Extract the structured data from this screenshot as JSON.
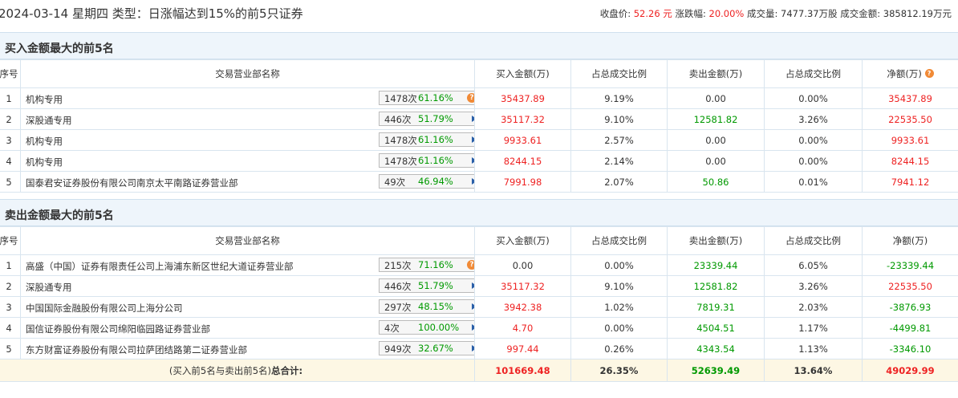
{
  "header": {
    "title": "2024-03-14 星期四 类型：日涨幅达到15%的前5只证券",
    "close_label": "收盘价:",
    "close_value": "52.26 元",
    "change_label": "涨跌幅:",
    "change_value": "20.00%",
    "volume_label": "成交量:",
    "volume_value": "7477.37万股",
    "amount_label": "成交金额:",
    "amount_value": "385812.19万元"
  },
  "columns": {
    "seq": "序号",
    "dept": "交易营业部名称",
    "buy": "买入金额(万)",
    "buy_ratio": "占总成交比例",
    "sell": "卖出金额(万)",
    "sell_ratio": "占总成交比例",
    "net": "净额(万)"
  },
  "buy_section": {
    "title": "买入金额最大的前5名",
    "rows": [
      {
        "seq": "1",
        "name": "机构专用",
        "count": "1478次",
        "rate": "61.16%",
        "buy": "35437.89",
        "buy_ratio": "9.19%",
        "sell": "0.00",
        "sell_ratio": "0.00%",
        "net": "35437.89"
      },
      {
        "seq": "2",
        "name": "深股通专用",
        "count": "446次",
        "rate": "51.79%",
        "buy": "35117.32",
        "buy_ratio": "9.10%",
        "sell": "12581.82",
        "sell_ratio": "3.26%",
        "net": "22535.50"
      },
      {
        "seq": "3",
        "name": "机构专用",
        "count": "1478次",
        "rate": "61.16%",
        "buy": "9933.61",
        "buy_ratio": "2.57%",
        "sell": "0.00",
        "sell_ratio": "0.00%",
        "net": "9933.61"
      },
      {
        "seq": "4",
        "name": "机构专用",
        "count": "1478次",
        "rate": "61.16%",
        "buy": "8244.15",
        "buy_ratio": "2.14%",
        "sell": "0.00",
        "sell_ratio": "0.00%",
        "net": "8244.15"
      },
      {
        "seq": "5",
        "name": "国泰君安证券股份有限公司南京太平南路证券营业部",
        "count": "49次",
        "rate": "46.94%",
        "buy": "7991.98",
        "buy_ratio": "2.07%",
        "sell": "50.86",
        "sell_ratio": "0.01%",
        "net": "7941.12"
      }
    ]
  },
  "sell_section": {
    "title": "卖出金额最大的前5名",
    "rows": [
      {
        "seq": "1",
        "name": "高盛（中国）证券有限责任公司上海浦东新区世纪大道证券营业部",
        "count": "215次",
        "rate": "71.16%",
        "buy": "0.00",
        "buy_ratio": "0.00%",
        "sell": "23339.44",
        "sell_ratio": "6.05%",
        "net": "-23339.44"
      },
      {
        "seq": "2",
        "name": "深股通专用",
        "count": "446次",
        "rate": "51.79%",
        "buy": "35117.32",
        "buy_ratio": "9.10%",
        "sell": "12581.82",
        "sell_ratio": "3.26%",
        "net": "22535.50"
      },
      {
        "seq": "3",
        "name": "中国国际金融股份有限公司上海分公司",
        "count": "297次",
        "rate": "48.15%",
        "buy": "3942.38",
        "buy_ratio": "1.02%",
        "sell": "7819.31",
        "sell_ratio": "2.03%",
        "net": "-3876.93"
      },
      {
        "seq": "4",
        "name": "国信证券股份有限公司绵阳临园路证券营业部",
        "count": "4次",
        "rate": "100.00%",
        "buy": "4.70",
        "buy_ratio": "0.00%",
        "sell": "4504.51",
        "sell_ratio": "1.17%",
        "net": "-4499.81"
      },
      {
        "seq": "5",
        "name": "东方财富证券股份有限公司拉萨团结路第二证券营业部",
        "count": "949次",
        "rate": "32.67%",
        "buy": "997.44",
        "buy_ratio": "0.26%",
        "sell": "4343.54",
        "sell_ratio": "1.13%",
        "net": "-3346.10"
      }
    ]
  },
  "total": {
    "label_prefix": "(买入前5名与卖出前5名)",
    "label_suffix": "总合计:",
    "buy": "101669.48",
    "buy_ratio": "26.35%",
    "sell": "52639.49",
    "sell_ratio": "13.64%",
    "net": "49029.99"
  },
  "colors": {
    "up": "#e22",
    "down": "#090",
    "header_bg": "#eef5fb",
    "total_bg": "#fdf7e4"
  },
  "icons": {
    "detail": "play-arrow-icon",
    "help": "question-icon"
  }
}
